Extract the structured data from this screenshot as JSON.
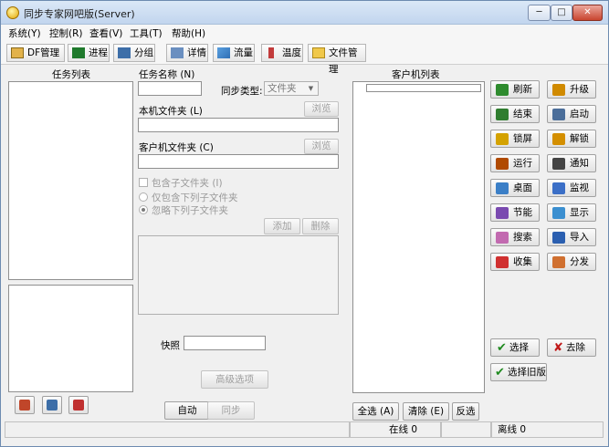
{
  "window": {
    "title": "同步专家网吧版(Server)",
    "minimize": "─",
    "maximize": "□",
    "close": "✕"
  },
  "menu": [
    "系统(Y)",
    "控制(R)",
    "查看(V)",
    "工具(T)",
    "帮助(H)"
  ],
  "toolbar": [
    "DF管理",
    "进程",
    "分组",
    "详情",
    "流量",
    "温度",
    "文件管理"
  ],
  "left": {
    "task_list_label": "任务列表"
  },
  "middle": {
    "task_name_label": "任务名称 (N)",
    "sync_type_label": "同步类型:",
    "sync_type_value": "文件夹",
    "local_folder_label": "本机文件夹 (L)",
    "browse_label": "浏览",
    "client_folder_label": "客户机文件夹 (C)",
    "include_subfolders": "包含子文件夹 (I)",
    "only_include": "仅包含下列子文件夹",
    "ignore_subfolders": "忽略下列子文件夹",
    "add_label": "添加",
    "delete_label": "删除",
    "snapshot_label": "快照",
    "advanced_label": "高级选项",
    "auto_label": "自动",
    "sync_label": "同步"
  },
  "right": {
    "client_list_label": "客户机列表",
    "select_all": "全选 (A)",
    "clear": "清除 (E)",
    "invert": "反选"
  },
  "side_buttons": [
    {
      "label": "刷新",
      "icon": "refresh-icon",
      "color": "#2e8b2e"
    },
    {
      "label": "升级",
      "icon": "upgrade-icon",
      "color": "#d08a00"
    },
    {
      "label": "结束",
      "icon": "end-icon",
      "color": "#2f7d2f"
    },
    {
      "label": "启动",
      "icon": "start-icon",
      "color": "#4b6e9a"
    },
    {
      "label": "锁屏",
      "icon": "lock-icon",
      "color": "#d4a200"
    },
    {
      "label": "解锁",
      "icon": "unlock-icon",
      "color": "#d48f00"
    },
    {
      "label": "运行",
      "icon": "run-icon",
      "color": "#b04a00"
    },
    {
      "label": "通知",
      "icon": "notify-icon",
      "color": "#444444"
    },
    {
      "label": "桌面",
      "icon": "desktop-icon",
      "color": "#3b7fc7"
    },
    {
      "label": "监视",
      "icon": "monitor-icon",
      "color": "#3b6fc7"
    },
    {
      "label": "节能",
      "icon": "power-icon",
      "color": "#7a4ab0"
    },
    {
      "label": "显示",
      "icon": "display-icon",
      "color": "#3b8fd0"
    },
    {
      "label": "搜索",
      "icon": "search-icon",
      "color": "#c26ab0"
    },
    {
      "label": "导入",
      "icon": "import-icon",
      "color": "#2b5fb0"
    },
    {
      "label": "收集",
      "icon": "collect-icon",
      "color": "#d03030"
    },
    {
      "label": "分发",
      "icon": "distribute-icon",
      "color": "#d07030"
    }
  ],
  "select_buttons": {
    "select": "选择",
    "remove": "去除",
    "select_old": "选择旧版"
  },
  "status": {
    "online": "在线 0",
    "offline": "离线 0"
  }
}
